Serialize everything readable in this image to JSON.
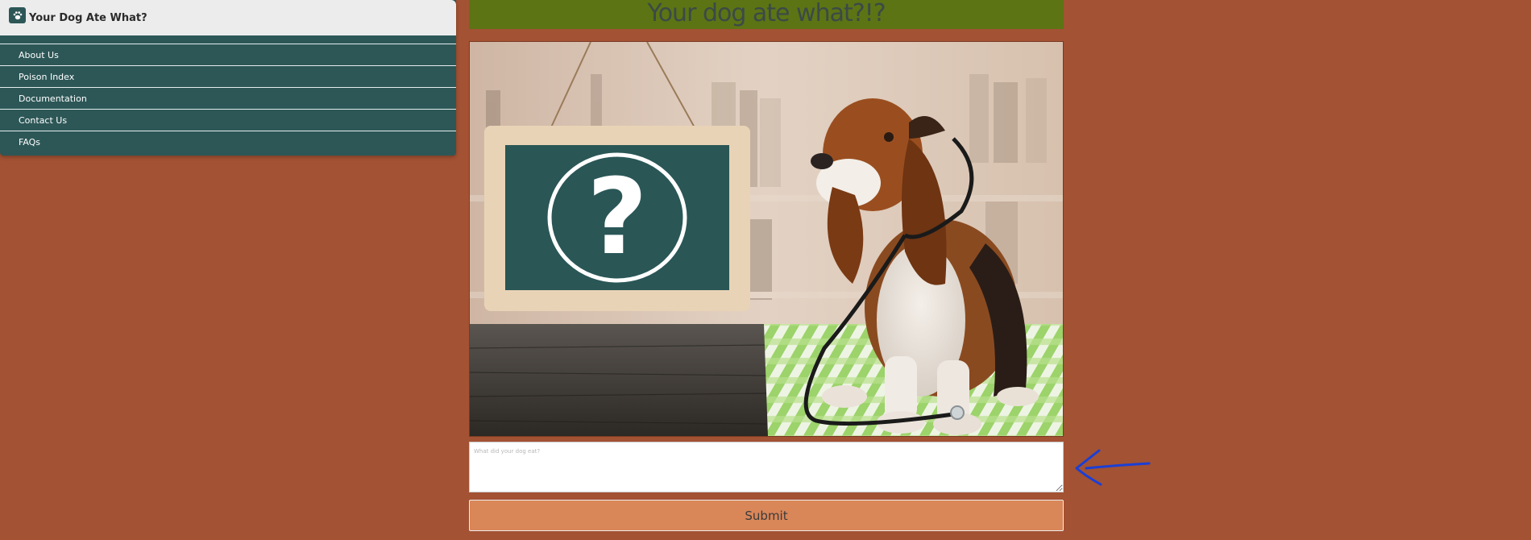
{
  "app": {
    "title": "Your Dog Ate What?",
    "brand_icon": "paw-icon"
  },
  "nav": {
    "items": [
      {
        "label": "About Us"
      },
      {
        "label": "Poison Index"
      },
      {
        "label": "Documentation"
      },
      {
        "label": "Contact Us"
      },
      {
        "label": "FAQs"
      }
    ]
  },
  "main": {
    "heading": "Your dog ate what?!?",
    "hero_image": "basset-hound-with-stethoscope-and-question-sign",
    "input_placeholder": "What did your dog eat?",
    "input_value": "",
    "submit_label": "Submit"
  },
  "annotation": {
    "icon": "arrow-left-icon",
    "color": "#1a3fd6"
  },
  "colors": {
    "background": "#a35233",
    "sidebar": "#2d5757",
    "header": "#5c7414",
    "button": "#d98659"
  }
}
